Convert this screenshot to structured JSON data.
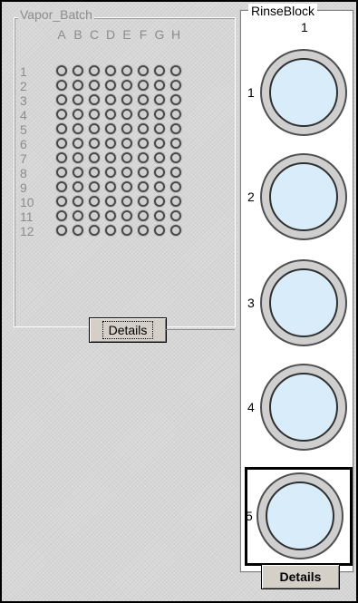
{
  "vapor_batch": {
    "title": "Vapor_Batch",
    "columns": [
      "A",
      "B",
      "C",
      "D",
      "E",
      "F",
      "G",
      "H"
    ],
    "rows": [
      "1",
      "2",
      "3",
      "4",
      "5",
      "6",
      "7",
      "8",
      "9",
      "10",
      "11",
      "12"
    ],
    "details_label": "Details"
  },
  "rinse_block": {
    "title": "RinseBlock",
    "column_label": "1",
    "positions": [
      "1",
      "2",
      "3",
      "4",
      "5"
    ],
    "selected_position": "5",
    "details_label": "Details"
  },
  "colors": {
    "well_fill": "#d8ecfa",
    "well_ring": "#cfcfcf",
    "panel_background": "#d7d7d7",
    "selection_border": "#000000"
  }
}
